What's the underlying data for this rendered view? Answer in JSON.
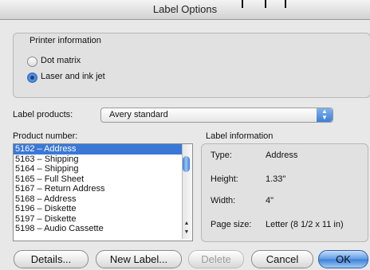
{
  "window": {
    "title": "Label Options"
  },
  "printer_info": {
    "legend": "Printer information",
    "options": [
      {
        "label": "Dot matrix",
        "selected": false
      },
      {
        "label": "Laser and ink jet",
        "selected": true
      }
    ]
  },
  "label_products": {
    "label": "Label products:",
    "value": "Avery standard"
  },
  "product_number": {
    "label": "Product number:",
    "items": [
      "5162 – Address",
      "5163 – Shipping",
      "5164 – Shipping",
      "5165 – Full Sheet",
      "5167 – Return Address",
      "5168 – Address",
      "5196 – Diskette",
      "5197 – Diskette",
      "5198 – Audio Cassette"
    ],
    "selected_index": 0
  },
  "label_info": {
    "legend": "Label information",
    "rows": [
      {
        "key": "Type:",
        "value": "Address"
      },
      {
        "key": "Height:",
        "value": "1.33\""
      },
      {
        "key": "Width:",
        "value": "4\""
      },
      {
        "key": "Page size:",
        "value": "Letter (8 1/2 x 11 in)"
      }
    ]
  },
  "buttons": {
    "details": "Details...",
    "new_label": "New Label...",
    "delete": "Delete",
    "cancel": "Cancel",
    "ok": "OK"
  },
  "colors": {
    "accent": "#3a78d6",
    "selection": "#3a78d6"
  }
}
